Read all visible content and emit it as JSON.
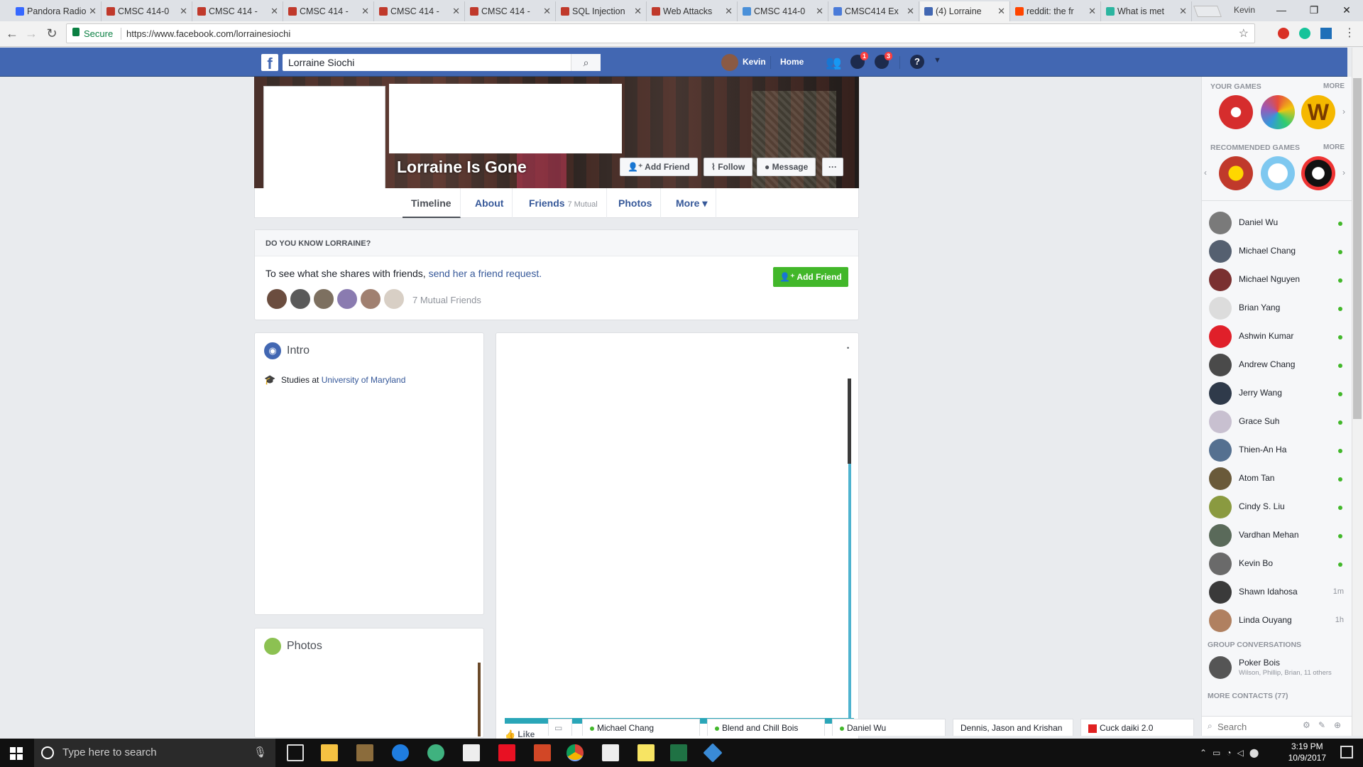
{
  "browser": {
    "tabs": [
      {
        "title": "Pandora Radio",
        "color": "#3668ff",
        "active": false
      },
      {
        "title": "CMSC 414-0",
        "color": "#c0392b",
        "active": false
      },
      {
        "title": "CMSC 414 -",
        "color": "#c0392b",
        "active": false
      },
      {
        "title": "CMSC 414 -",
        "color": "#c0392b",
        "active": false
      },
      {
        "title": "CMSC 414 -",
        "color": "#c0392b",
        "active": false
      },
      {
        "title": "CMSC 414 -",
        "color": "#c0392b",
        "active": false
      },
      {
        "title": "SQL Injection",
        "color": "#c0392b",
        "active": false
      },
      {
        "title": "Web Attacks",
        "color": "#c0392b",
        "active": false
      },
      {
        "title": "CMSC 414-0",
        "color": "#4a90d9",
        "active": false
      },
      {
        "title": "CMSC414 Ex",
        "color": "#4a7bd9",
        "active": false
      },
      {
        "title": "(4) Lorraine",
        "color": "#4267b2",
        "active": true
      },
      {
        "title": "reddit: the fr",
        "color": "#ff4500",
        "active": false
      },
      {
        "title": "What is met",
        "color": "#2bb5a0",
        "active": false
      }
    ],
    "profile_name": "Kevin",
    "secure_label": "Secure",
    "url": "https://www.facebook.com/lorrainesiochi"
  },
  "fb": {
    "search_value": "Lorraine Siochi",
    "user_name": "Kevin",
    "home_label": "Home",
    "messages_badge": "1",
    "notif_badge": "3"
  },
  "profile": {
    "cover_name": "Lorraine Is Gone",
    "add_friend": "Add Friend",
    "follow": "Follow",
    "message": "Message",
    "more_dots": "···",
    "tabs": {
      "timeline": "Timeline",
      "about": "About",
      "friends": "Friends",
      "friends_mutual": "7 Mutual",
      "photos": "Photos",
      "more": "More ▾"
    }
  },
  "know": {
    "header": "DO YOU KNOW LORRAINE?",
    "text": "To see what she shares with friends, ",
    "link": "send her a friend request.",
    "button": "Add Friend",
    "mutual": "7 Mutual Friends"
  },
  "intro": {
    "title": "Intro",
    "studies_prefix": "Studies at ",
    "school": "University of Maryland"
  },
  "photos": {
    "title": "Photos"
  },
  "post": {
    "like_label": "Like"
  },
  "sidebar": {
    "your_games": "YOUR GAMES",
    "recommended_games": "RECOMMENDED GAMES",
    "more": "MORE",
    "contacts": [
      {
        "name": "Daniel Wu",
        "status": "online"
      },
      {
        "name": "Michael Chang",
        "status": "online"
      },
      {
        "name": "Michael Nguyen",
        "status": "online"
      },
      {
        "name": "Brian Yang",
        "status": "online"
      },
      {
        "name": "Ashwin Kumar",
        "status": "online"
      },
      {
        "name": "Andrew Chang",
        "status": "online"
      },
      {
        "name": "Jerry Wang",
        "status": "online"
      },
      {
        "name": "Grace Suh",
        "status": "online"
      },
      {
        "name": "Thien-An Ha",
        "status": "online"
      },
      {
        "name": "Atom Tan",
        "status": "online"
      },
      {
        "name": "Cindy S. Liu",
        "status": "online"
      },
      {
        "name": "Vardhan Mehan",
        "status": "online"
      },
      {
        "name": "Kevin Bo",
        "status": "online"
      },
      {
        "name": "Shawn Idahosa",
        "status": "1m"
      },
      {
        "name": "Linda Ouyang",
        "status": "1h"
      }
    ],
    "group_header": "GROUP CONVERSATIONS",
    "group_name": "Poker Bois",
    "group_members": "Wilson, Phillip, Brian, 11 others",
    "more_contacts": "MORE CONTACTS (77)",
    "search_placeholder": "Search"
  },
  "chat_tabs": [
    "Michael Chang",
    "Blend and Chill Bois",
    "Daniel Wu",
    "Dennis, Jason and Krishan",
    "Cuck daiki 2.0"
  ],
  "taskbar": {
    "search_placeholder": "Type here to search",
    "time": "3:19 PM",
    "date": "10/9/2017"
  }
}
